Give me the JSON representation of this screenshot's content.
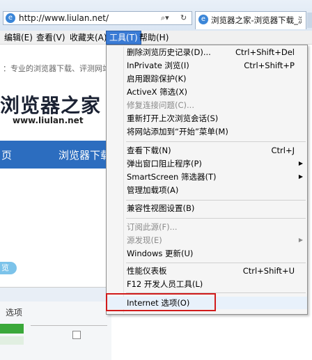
{
  "address_bar": {
    "url": "http://www.liulan.net/",
    "search_icon": "search-icon",
    "refresh_icon": "refresh-icon"
  },
  "tab": {
    "title": "浏览器之家-浏览器下载_浏…"
  },
  "menubar": [
    {
      "label": "编辑(E)"
    },
    {
      "label": "查看(V)"
    },
    {
      "label": "收藏夹(A)"
    },
    {
      "label": "工具(T)",
      "active": true
    },
    {
      "label": "帮助(H)"
    }
  ],
  "page": {
    "slogan": "：专业的浏览器下载、评测网站",
    "logo_text": "浏览器之家",
    "logo_url": "www.liulan.net",
    "nav_1": "页",
    "nav_2": "浏览器下载",
    "badge": "览",
    "shot_title": "选项"
  },
  "tools_menu": {
    "items": [
      {
        "label": "删除浏览历史记录(D)...",
        "shortcut": "Ctrl+Shift+Del"
      },
      {
        "label": "InPrivate 浏览(I)",
        "shortcut": "Ctrl+Shift+P"
      },
      {
        "label": "启用跟踪保护(K)",
        "shortcut": ""
      },
      {
        "label": "ActiveX 筛选(X)",
        "shortcut": ""
      },
      {
        "label": "修复连接问题(C)...",
        "shortcut": "",
        "disabled": true
      },
      {
        "label": "重新打开上次浏览会话(S)",
        "shortcut": ""
      },
      {
        "label": "将网站添加到“开始”菜单(M)",
        "shortcut": ""
      },
      {
        "label": "查看下载(N)",
        "shortcut": "Ctrl+J"
      },
      {
        "label": "弹出窗口阻止程序(P)",
        "shortcut": "",
        "submenu": true
      },
      {
        "label": "SmartScreen 筛选器(T)",
        "shortcut": "",
        "submenu": true
      },
      {
        "label": "管理加载项(A)",
        "shortcut": ""
      },
      {
        "label": "兼容性视图设置(B)",
        "shortcut": ""
      },
      {
        "label": "订阅此源(F)...",
        "shortcut": "",
        "disabled": true
      },
      {
        "label": "源发现(E)",
        "shortcut": "",
        "disabled": true,
        "submenu": true
      },
      {
        "label": "Windows 更新(U)",
        "shortcut": ""
      },
      {
        "label": "性能仪表板",
        "shortcut": "Ctrl+Shift+U"
      },
      {
        "label": "F12 开发人员工具(L)",
        "shortcut": ""
      },
      {
        "label": "Internet 选项(O)",
        "shortcut": "",
        "highlighted": true
      }
    ]
  },
  "colors": {
    "accent": "#3a7bd5",
    "highlight_box": "#d11b1b"
  }
}
